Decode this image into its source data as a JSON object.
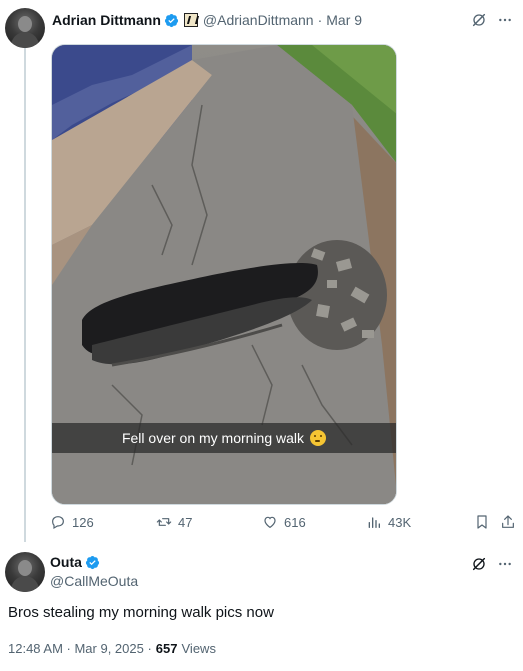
{
  "tweet": {
    "author_name": "Adrian Dittmann",
    "author_handle": "@AdrianDittmann",
    "separator": "·",
    "date": "Mar 9",
    "media_caption": "Fell over on my morning walk",
    "actions": {
      "replies": "126",
      "reposts": "47",
      "likes": "616",
      "views": "43K"
    }
  },
  "reply": {
    "author_name": "Outa",
    "author_handle": "@CallMeOuta",
    "text": "Bros stealing my morning walk pics now",
    "timestamp": "12:48 AM · Mar 9, 2025 ·",
    "views_count": "657",
    "views_label": "Views"
  },
  "colors": {
    "verified": "#1d9bf0",
    "text_primary": "#0f1419",
    "text_secondary": "#536471",
    "thread_line": "#cfd9de"
  },
  "icons": [
    "grok-icon",
    "more-icon",
    "reply-icon",
    "repost-icon",
    "like-icon",
    "views-icon",
    "bookmark-icon",
    "share-icon",
    "verified-icon"
  ]
}
